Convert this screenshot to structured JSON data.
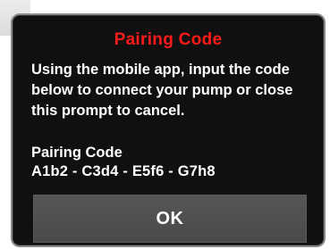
{
  "dialog": {
    "title": "Pairing Code",
    "message": "Using the mobile app, input the code below to connect your pump or close this prompt to cancel.",
    "code_label": "Pairing Code",
    "code_value": "A1b2 - C3d4 - E5f6 - G7h8",
    "ok_label": "OK"
  },
  "colors": {
    "title": "#ff1a1a",
    "dialog_background": "#101010",
    "button_background": "#4f4f4f",
    "text": "#ffffff"
  }
}
